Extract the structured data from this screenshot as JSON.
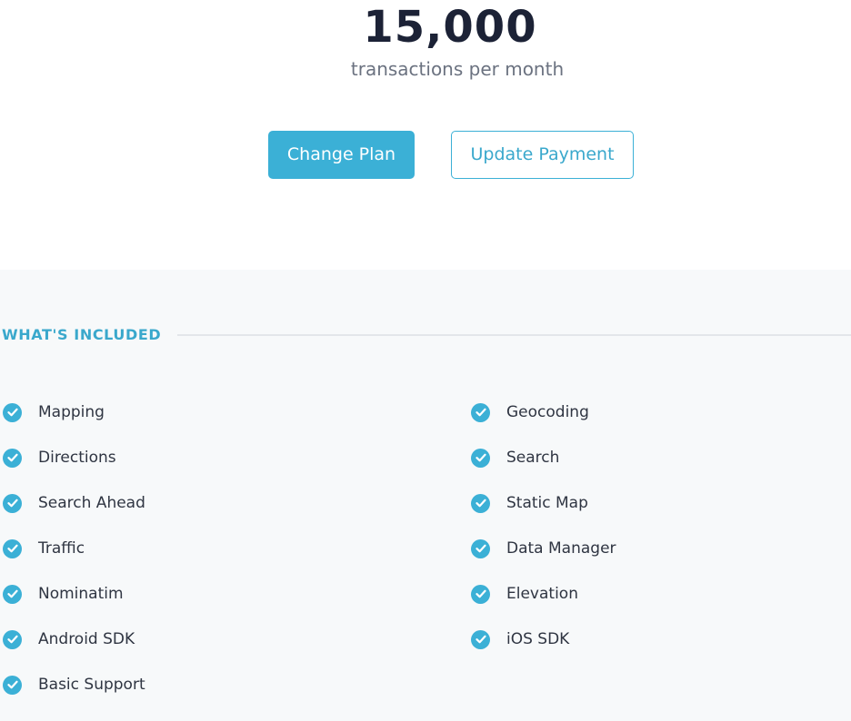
{
  "plan": {
    "transactions": "15,000",
    "unit": "transactions per month"
  },
  "actions": {
    "change_plan": "Change Plan",
    "update_payment": "Update Payment"
  },
  "included": {
    "title": "WHAT'S INCLUDED",
    "left": [
      "Mapping",
      "Directions",
      "Search Ahead",
      "Traffic",
      "Nominatim",
      "Android SDK",
      "Basic Support"
    ],
    "right": [
      "Geocoding",
      "Search",
      "Static Map",
      "Data Manager",
      "Elevation",
      "iOS SDK"
    ],
    "icon": "check-circle-icon"
  },
  "colors": {
    "accent": "#3bb0d6",
    "heading": "#1c2236",
    "muted": "#6b7280",
    "section_bg": "#f7f9fa"
  }
}
